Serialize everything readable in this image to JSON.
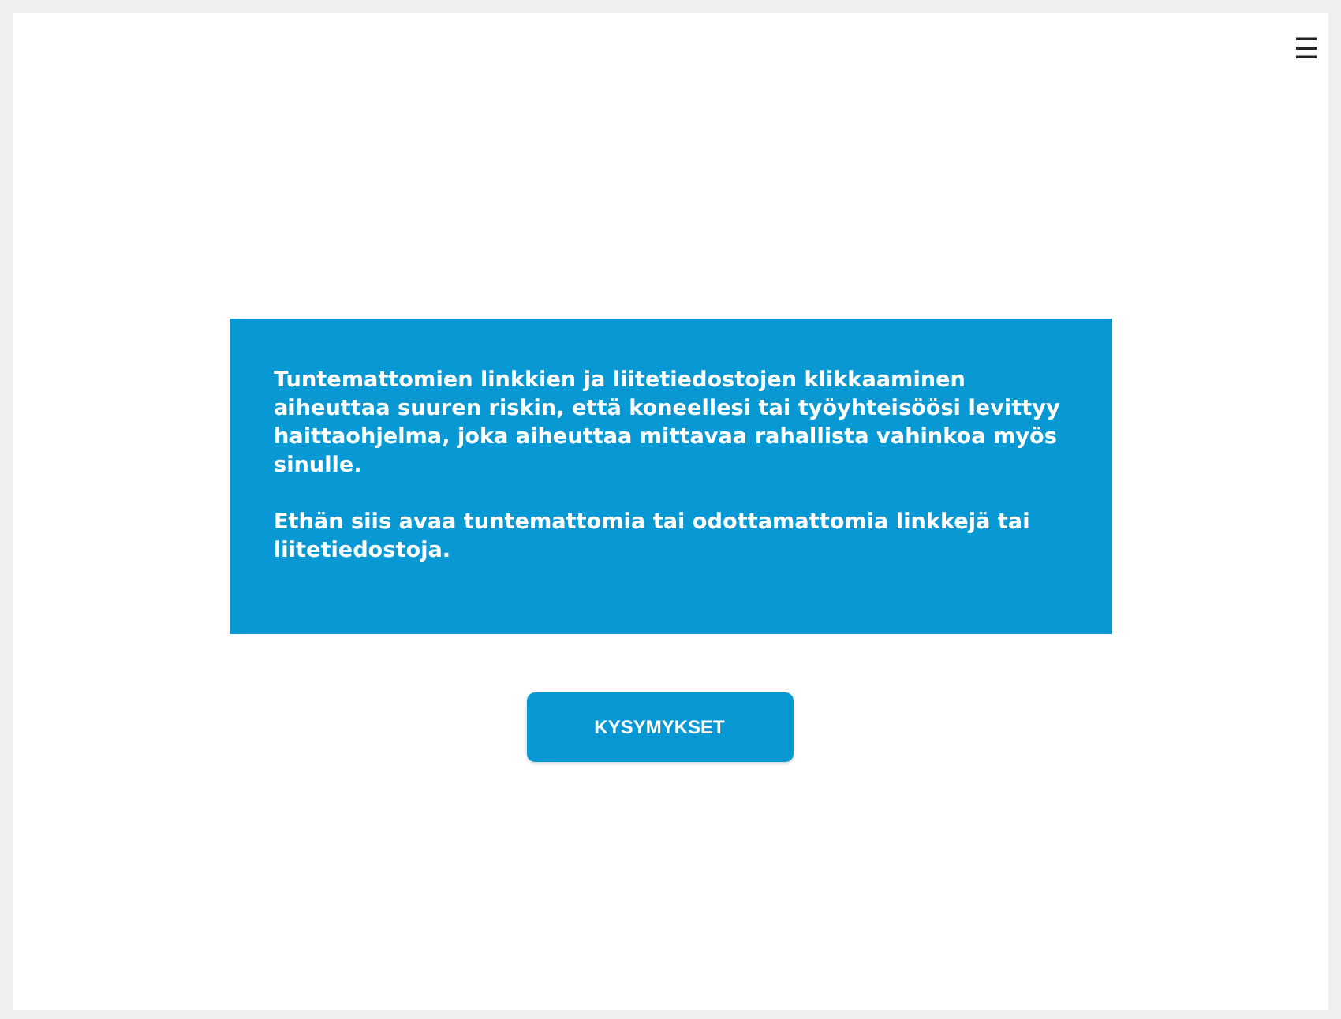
{
  "menu": {
    "icon": "☰"
  },
  "notice": {
    "paragraphs": [
      "Tuntemattomien linkkien ja liitetiedostojen klikkaaminen aiheuttaa suuren riskin, että koneellesi tai työyhteisöösi levittyy haittaohjelma, joka aiheuttaa mittavaa rahallista vahinkoa myös sinulle.",
      "Ethän siis avaa tuntemattomia tai odottamattomia linkkejä tai liitetiedostoja."
    ]
  },
  "button": {
    "label": "KYSYMYKSET"
  }
}
